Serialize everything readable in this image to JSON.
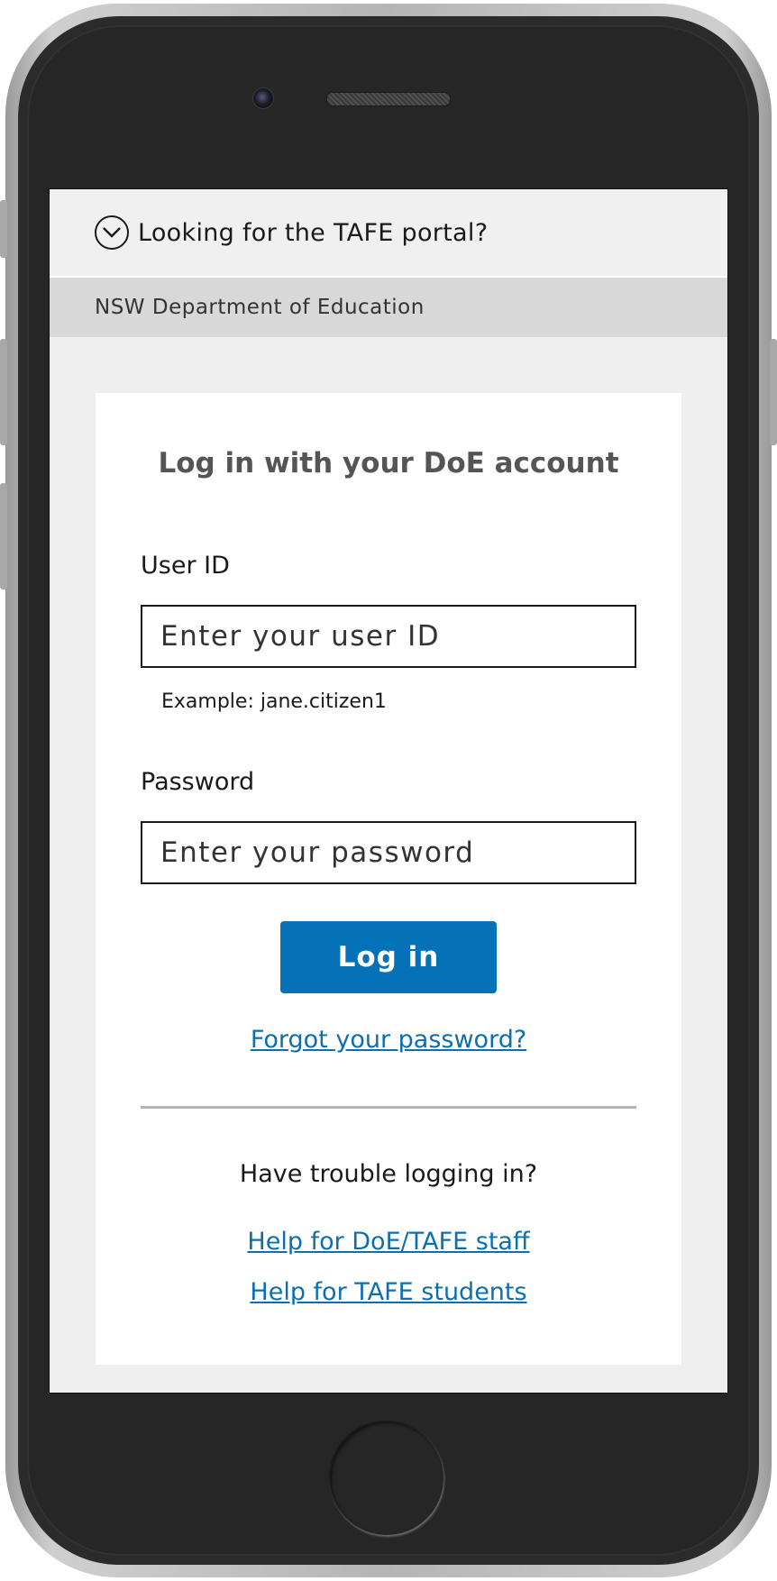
{
  "tafe_banner": {
    "label": "Looking for the TAFE portal?",
    "icon": "chevron-down-circle-icon"
  },
  "department": {
    "name": "NSW Department of Education"
  },
  "login_card": {
    "title": "Log in with your DoE account",
    "user_id": {
      "label": "User ID",
      "placeholder": "Enter your user ID",
      "value": "",
      "hint": "Example: jane.citizen1"
    },
    "password": {
      "label": "Password",
      "placeholder": "Enter your password",
      "value": ""
    },
    "login_button": "Log in",
    "forgot_password": "Forgot your password?",
    "trouble_heading": "Have trouble logging in?",
    "help_links": [
      "Help for DoE/TAFE staff",
      "Help for TAFE students"
    ]
  },
  "colors": {
    "primary_button": "#0571b6",
    "link": "#0b6fb0",
    "page_bg": "#efefef",
    "department_bar": "#d8d8d8"
  }
}
